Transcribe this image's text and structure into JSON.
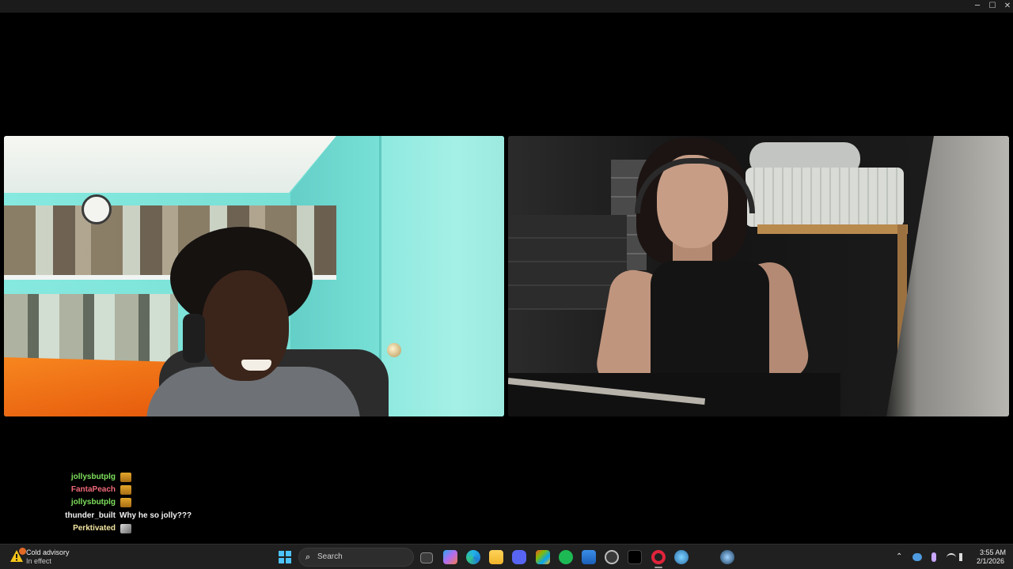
{
  "window": {
    "controls": {
      "minimize": "─",
      "maximize": "☐",
      "close": "✕"
    }
  },
  "chat": {
    "messages": [
      {
        "user": "jollysbutplg",
        "user_color": "#7ee05c",
        "text": "",
        "emote": "jolly-emote"
      },
      {
        "user": "FantaPeach",
        "user_color": "#f06a7a",
        "text": "",
        "emote": "jolly-emote"
      },
      {
        "user": "jollysbutplg",
        "user_color": "#7ee05c",
        "text": "",
        "emote": "jolly-emote"
      },
      {
        "user": "thunder_built",
        "user_color": "#f2f2f2",
        "text": "Why he so jolly???",
        "emote": ""
      },
      {
        "user": "Perktivated",
        "user_color": "#f2e6a2",
        "text": "",
        "emote": "avatar-emote"
      }
    ]
  },
  "taskbar": {
    "weather": {
      "title": "Cold advisory",
      "subtitle": "In effect",
      "badge": "2"
    },
    "search_placeholder": "Search",
    "apps": [
      "task-view",
      "copilot",
      "edge",
      "file-explorer",
      "discord",
      "microsoft-store",
      "spotify",
      "mail",
      "settings",
      "tiktok",
      "opera-gx",
      "browser",
      "steam"
    ],
    "tray": {
      "chevron": "⌃",
      "clock_time": "3:55 AM",
      "clock_date": "2/1/2026"
    }
  }
}
